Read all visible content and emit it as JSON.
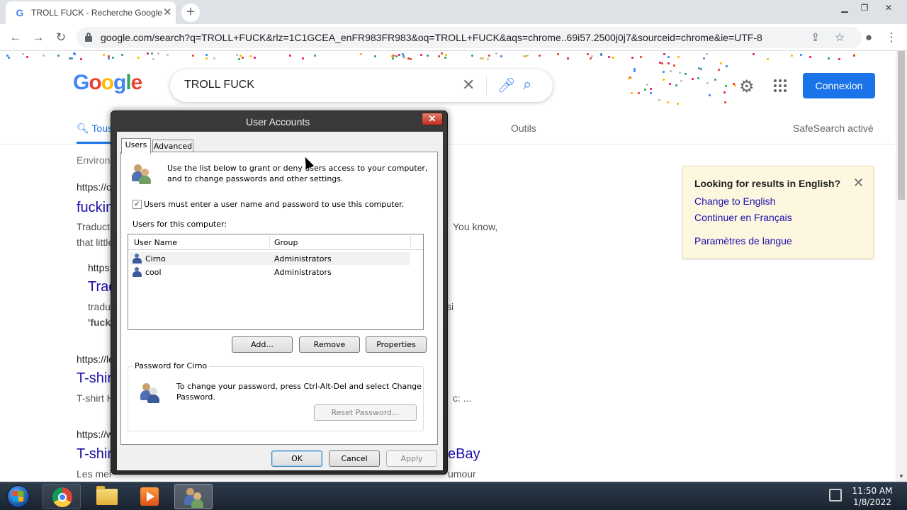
{
  "browser": {
    "tab_title": "TROLL FUCK - Recherche Google",
    "tab_favicon": "G",
    "url": "google.com/search?q=TROLL+FUCK&rlz=1C1GCEA_enFR983FR983&oq=TROLL+FUCK&aqs=chrome..69i57.2500j0j7&sourceid=chrome&ie=UTF-8"
  },
  "google": {
    "logo": "Google",
    "query": "TROLL FUCK",
    "connexion": "Connexion",
    "tabs": {
      "all": "Tous",
      "tools": "Outils",
      "safesearch": "SafeSearch activé"
    },
    "results_count": "Environ",
    "results": [
      {
        "url": "https://c",
        "title": "fuckin",
        "snippet1": "Traductio",
        "snippet1_end": "You know,",
        "snippet2": "that little"
      },
      {
        "url": "https:",
        "title": "Trad",
        "snippet1": "traduc",
        "snippet1_end": "si",
        "snippet2": "'fuck'"
      },
      {
        "url": "https://le",
        "title": "T-shir",
        "snippet1": "T-shirt H",
        "snippet1_end": "c: ..."
      },
      {
        "url": "https://w",
        "title": "T-shir",
        "title_end": "eBay",
        "snippet1": "Les mei",
        "snippet1_end": "umour"
      }
    ],
    "english_box": {
      "title": "Looking for results in English?",
      "link1": "Change to English",
      "link2": "Continuer en Français",
      "link3": "Paramètres de langue"
    },
    "colors": {
      "accent": "#1a73e8",
      "link": "#1a0dab"
    }
  },
  "dialog": {
    "title": "User Accounts",
    "tabs": [
      "Users",
      "Advanced"
    ],
    "intro_line1": "Use the list below to grant or deny users access to your computer,",
    "intro_line2": "and to change passwords and other settings.",
    "checkbox_label": "Users must enter a user name and password to use this computer.",
    "checkbox_checked": true,
    "list_label": "Users for this computer:",
    "columns": [
      "User Name",
      "Group"
    ],
    "rows": [
      {
        "name": "Cirno",
        "group": "Administrators",
        "selected": true
      },
      {
        "name": "cool",
        "group": "Administrators",
        "selected": false
      }
    ],
    "buttons": {
      "add": "Add...",
      "remove": "Remove",
      "properties": "Properties"
    },
    "password_group": "Password for Cirno",
    "password_line1": "To change your password, press Ctrl-Alt-Del and select Change",
    "password_line2": "Password.",
    "reset_password": "Reset Password...",
    "ok": "OK",
    "cancel": "Cancel",
    "apply": "Apply"
  },
  "taskbar": {
    "time": "11:50 AM",
    "date": "1/8/2022"
  }
}
